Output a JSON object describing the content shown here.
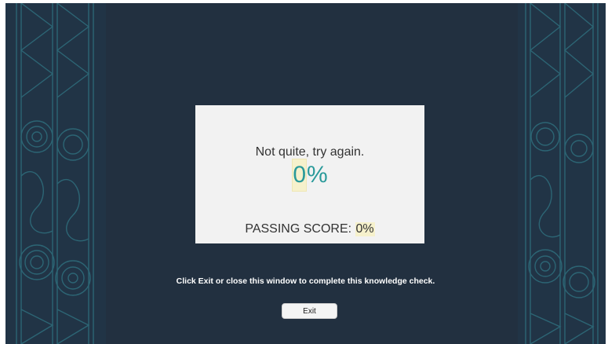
{
  "result": {
    "message": "Not quite, try again.",
    "score_number": "0",
    "score_unit": "%",
    "passing_label": "PASSING SCORE: ",
    "passing_value": "0%"
  },
  "instruction": "Click Exit or close this window to complete this knowledge check.",
  "exit_label": "Exit",
  "colors": {
    "stage_background": "#223040",
    "border_pattern": "#2f6e7d",
    "card_background": "#f2f2f2",
    "score_color": "#2a9a9a",
    "highlight": "#f6f1cc"
  },
  "icons": {
    "border_pattern": "maori-kowhaiwhai-pattern-icon"
  }
}
